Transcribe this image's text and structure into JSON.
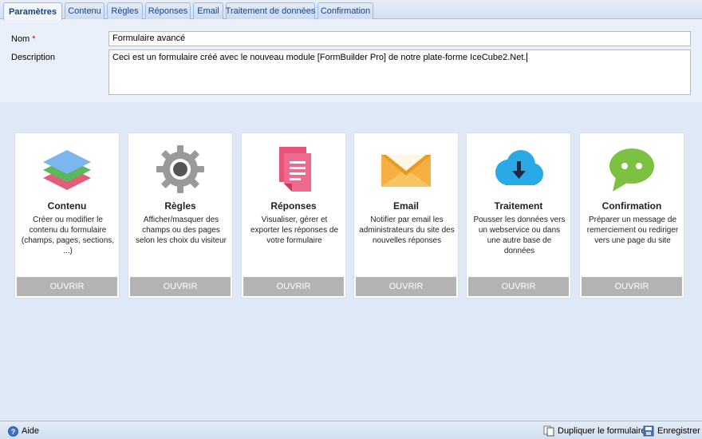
{
  "tabs": [
    {
      "label": "Paramètres",
      "active": true
    },
    {
      "label": "Contenu"
    },
    {
      "label": "Règles"
    },
    {
      "label": "Réponses"
    },
    {
      "label": "Email"
    },
    {
      "label": "Traitement de données"
    },
    {
      "label": "Confirmation"
    }
  ],
  "form": {
    "name_label": "Nom",
    "required_mark": "*",
    "name_value": "Formulaire avancé",
    "description_label": "Description",
    "description_value": "Ceci est un formulaire créé avec le nouveau module [FormBuilder Pro] de notre plate-forme IceCube2.Net."
  },
  "cards": [
    {
      "icon": "layers-icon",
      "title": "Contenu",
      "description": "Créer ou modifier le contenu du formulaire (champs, pages, sections, ...)",
      "button": "OUVRIR"
    },
    {
      "icon": "gear-icon",
      "title": "Règles",
      "description": "Afficher/masquer des champs ou des pages selon les choix du visiteur",
      "button": "OUVRIR"
    },
    {
      "icon": "documents-icon",
      "title": "Réponses",
      "description": "Visualiser, gérer et exporter les réponses de votre formulaire",
      "button": "OUVRIR"
    },
    {
      "icon": "envelope-icon",
      "title": "Email",
      "description": "Notifier par email les administrateurs du site des nouvelles réponses",
      "button": "OUVRIR"
    },
    {
      "icon": "cloud-download-icon",
      "title": "Traitement",
      "description": "Pousser les données vers un webservice ou dans une autre base de données",
      "button": "OUVRIR"
    },
    {
      "icon": "chat-bubble-icon",
      "title": "Confirmation",
      "description": "Préparer un message de remerciement ou rediriger vers une page du site",
      "button": "OUVRIR"
    }
  ],
  "footer": {
    "help_label": "Aide",
    "duplicate_label": "Dupliquer le formulaire",
    "save_label": "Enregistrer"
  },
  "colors": {
    "background": "#dfe8f6",
    "tab_text": "#15428b",
    "button_gray": "#b3b3b3",
    "required": "#cc0000"
  }
}
